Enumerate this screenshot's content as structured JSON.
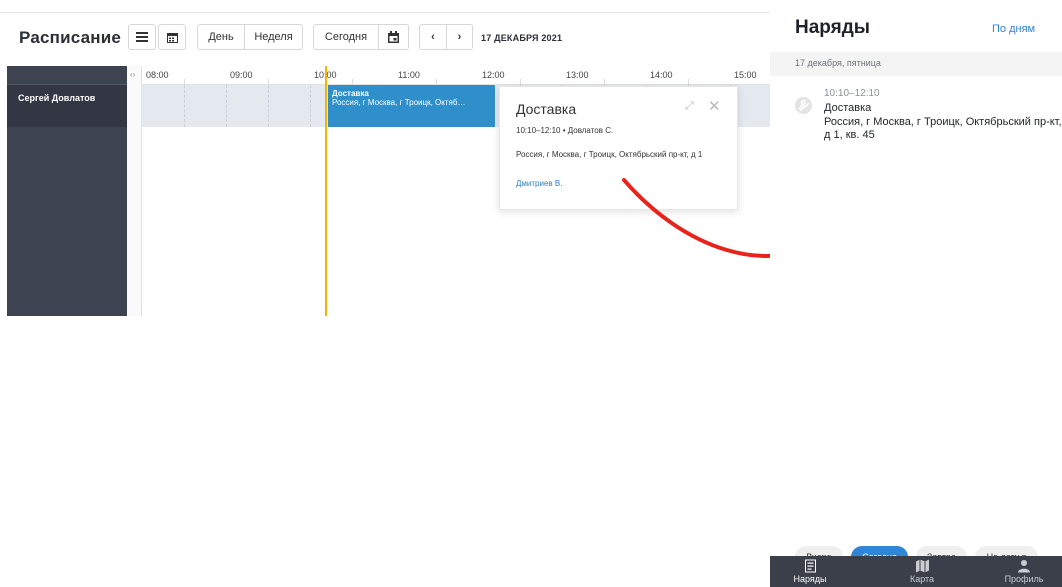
{
  "schedule": {
    "title": "Расписание",
    "view_day": "День",
    "view_week": "Неделя",
    "today": "Сегодня",
    "date_label": "17 ДЕКАБРЯ 2021",
    "resource": "Сергей Довлатов",
    "hours": [
      "08:00",
      "09:00",
      "10:00",
      "11:00",
      "12:00",
      "13:00",
      "14:00",
      "15:00"
    ],
    "event": {
      "title": "Доставка",
      "address": "Россия, г Москва, г Троицк, Октяб…"
    },
    "popover": {
      "title": "Доставка",
      "time": "10:10–12:10 • Довлатов С.",
      "address": "Россия, г Москва, г Троицк, Октябрьский пр-кт, д 1",
      "assignee": "Дмитриев В."
    }
  },
  "mobile": {
    "title": "Наряды",
    "by_days": "По дням",
    "date": "17 декабря, пятница",
    "item": {
      "time": "10:10–12:10",
      "name": "Доставка",
      "address": "Россия, г Москва, г Троицк, Октябрьский пр-кт, д 1, кв. 45"
    },
    "filters": {
      "yesterday": "Вчера",
      "today": "Сегодня",
      "tomorrow": "Завтра",
      "on_date": "На дату ▾"
    },
    "tabs": {
      "orders": "Наряды",
      "map": "Карта",
      "profile": "Профиль"
    }
  },
  "colors": {
    "accent": "#2f86d6",
    "event": "#2f8fca",
    "now_line": "#f4b400",
    "arrow": "#e8231b",
    "sidebar": "#3d4350"
  }
}
